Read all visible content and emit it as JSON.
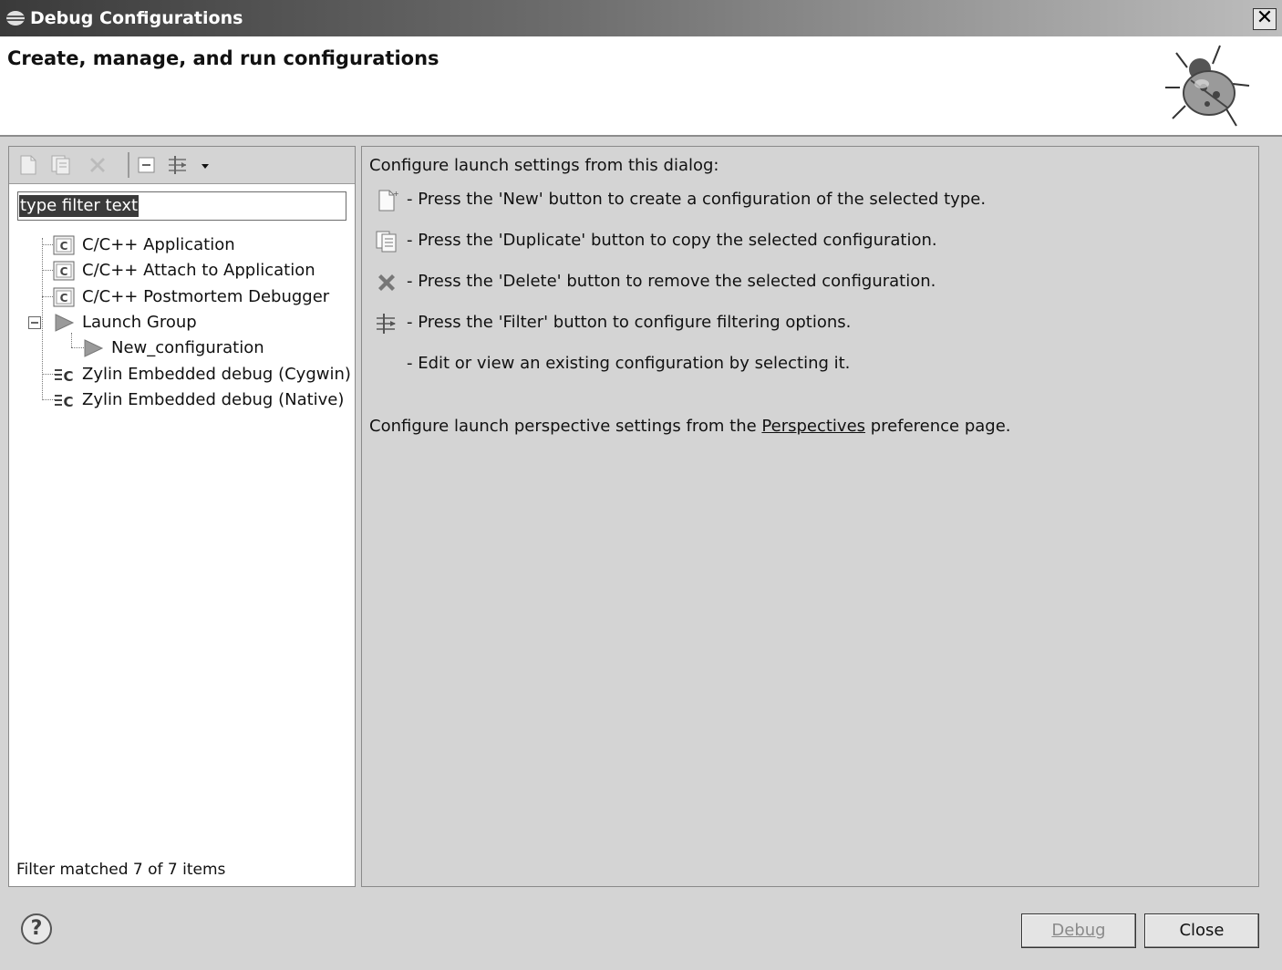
{
  "window": {
    "title": "Debug Configurations",
    "close_glyph": "✕"
  },
  "banner": {
    "heading": "Create, manage, and run configurations",
    "icon": "bug-icon"
  },
  "left": {
    "filter_text": "type filter text",
    "status": "Filter matched 7 of 7 items",
    "tree": [
      {
        "label": "C/C++ Application",
        "icon": "c-config-icon"
      },
      {
        "label": "C/C++ Attach to Application",
        "icon": "c-config-icon"
      },
      {
        "label": "C/C++ Postmortem Debugger",
        "icon": "c-config-icon"
      },
      {
        "label": "Launch Group",
        "icon": "launch-group-icon",
        "expanded": true
      },
      {
        "label": "New_configuration",
        "icon": "launch-group-icon"
      },
      {
        "label": "Zylin Embedded debug (Cygwin)",
        "icon": "zylin-icon"
      },
      {
        "label": "Zylin Embedded debug (Native)",
        "icon": "zylin-icon"
      }
    ]
  },
  "right": {
    "intro": "Configure launch settings from this dialog:",
    "items": [
      {
        "icon": "new-icon",
        "text": "- Press the 'New' button to create a configuration of the selected type."
      },
      {
        "icon": "duplicate-icon",
        "text": "- Press the 'Duplicate' button to copy the selected configuration."
      },
      {
        "icon": "delete-icon",
        "text": "- Press the 'Delete' button to remove the selected configuration."
      },
      {
        "icon": "filter-icon",
        "text": "- Press the 'Filter' button to configure filtering options."
      },
      {
        "icon": "",
        "text": "- Edit or view an existing configuration by selecting it."
      }
    ],
    "persp_prefix": "Configure launch perspective settings from the ",
    "persp_link": "Perspectives",
    "persp_suffix": " preference page."
  },
  "footer": {
    "help": "?",
    "debug_label": "Debug",
    "close_label": "Close"
  }
}
